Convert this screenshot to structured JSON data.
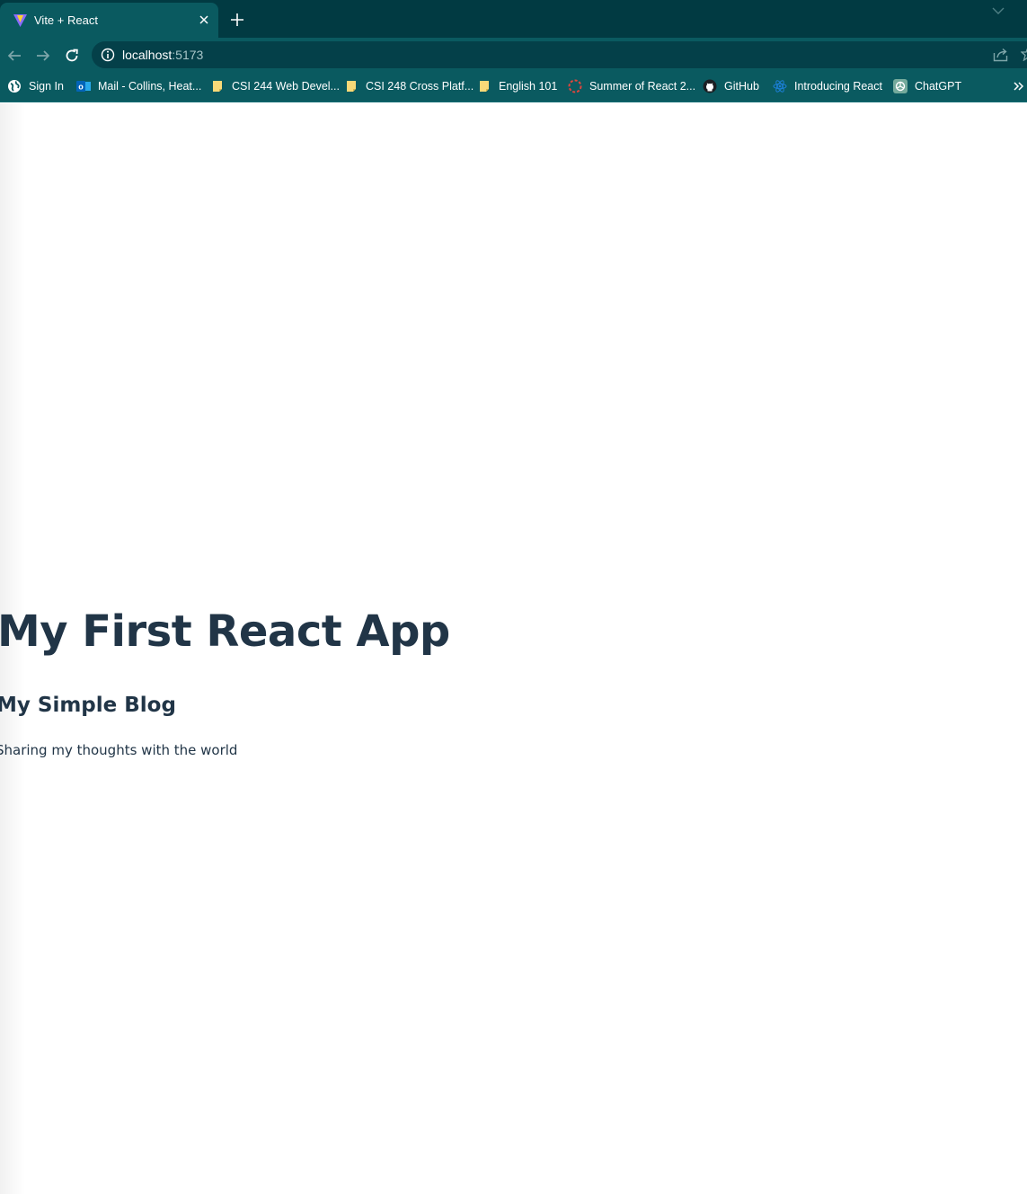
{
  "browser": {
    "tab": {
      "title": "Vite + React",
      "favicon": "vite-logo-icon"
    },
    "url": {
      "host": "localhost",
      "port": ":5173"
    },
    "bookmarks": [
      {
        "label": "Sign In",
        "icon": "globe-icon"
      },
      {
        "label": "Mail - Collins, Heat...",
        "icon": "outlook-icon"
      },
      {
        "label": "CSI 244 Web Devel...",
        "icon": "note-icon"
      },
      {
        "label": "CSI 248 Cross Platf...",
        "icon": "note-icon"
      },
      {
        "label": "English 101",
        "icon": "note-icon"
      },
      {
        "label": "Summer of React 2...",
        "icon": "dotted-circle-icon"
      },
      {
        "label": "GitHub",
        "icon": "github-icon"
      },
      {
        "label": "Introducing React",
        "icon": "react-icon"
      },
      {
        "label": "ChatGPT",
        "icon": "chatgpt-icon"
      }
    ],
    "colors": {
      "tabstrip": "#013a42",
      "toolbar": "#0a5a60",
      "omnibox": "#044049"
    }
  },
  "page": {
    "title": "My First React App",
    "blog": {
      "title": "My Simple Blog",
      "tagline": "Sharing my thoughts with the world"
    },
    "colors": {
      "text": "#213547",
      "background": "#ffffff"
    }
  }
}
